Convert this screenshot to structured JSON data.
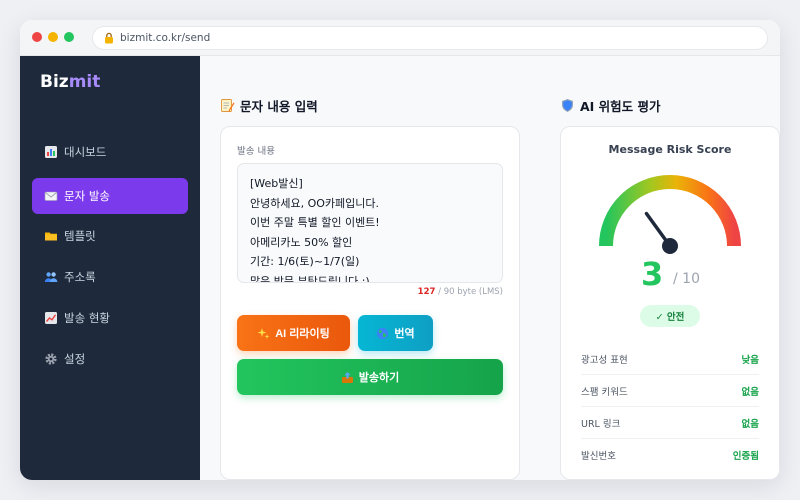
{
  "browser": {
    "url": "bizmit.co.kr/send"
  },
  "sidebar": {
    "logo_main": "Biz",
    "logo_accent": "mit",
    "items": [
      {
        "label": "대시보드",
        "icon": "chart-icon"
      },
      {
        "label": "문자 발송",
        "icon": "envelope-icon",
        "active": true
      },
      {
        "label": "템플릿",
        "icon": "folder-icon"
      },
      {
        "label": "주소록",
        "icon": "people-icon"
      },
      {
        "label": "발송 현황",
        "icon": "trend-icon"
      },
      {
        "label": "설정",
        "icon": "gear-icon"
      }
    ]
  },
  "compose": {
    "title": "문자 내용 입력",
    "field_label": "발송 내용",
    "message_lines": [
      "[Web발신]",
      "안녕하세요, OO카페입니다.",
      "이번 주말 특별 할인 이벤트!",
      "아메리카노 50% 할인",
      "기간: 1/6(토)~1/7(일)",
      "많은 방문 부탁드립니다 :)"
    ],
    "byte_current": "127",
    "byte_limit": " / 90 byte (LMS)",
    "ai_rewrite_label": "AI 리라이팅",
    "translate_label": "번역",
    "send_label": "발송하기"
  },
  "risk": {
    "title": "AI 위험도 평가",
    "gauge_title": "Message Risk Score",
    "score": 3,
    "score_text": "3",
    "score_max_text": "/ 10",
    "badge": "✓ 안전",
    "rows": [
      {
        "label": "광고성 표현",
        "value": "낮음"
      },
      {
        "label": "스팸 키워드",
        "value": "없음"
      },
      {
        "label": "URL 링크",
        "value": "없음"
      },
      {
        "label": "발신번호",
        "value": "인증됨"
      }
    ]
  },
  "colors": {
    "sidebar_bg": "#1e293b",
    "active_nav": "#7c3aed",
    "safe_green": "#22c55e",
    "ai_orange": "#f97316",
    "translate_cyan": "#06b6d4",
    "warn_red": "#dc2626"
  }
}
